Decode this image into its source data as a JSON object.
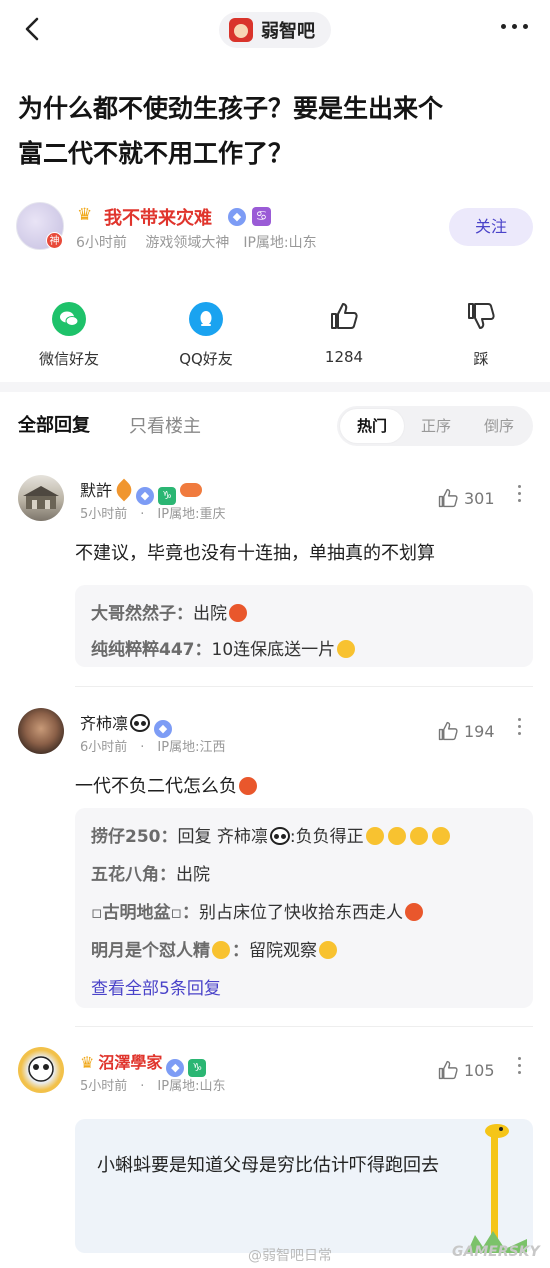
{
  "header": {
    "forum_name": "弱智吧"
  },
  "post": {
    "title_line1": "为什么都不使劲生孩子？要是生出来个",
    "title_line2": "富二代不就不用工作了？"
  },
  "author": {
    "name": "我不带来灾难",
    "badge": "神",
    "meta": "6小时前　 游戏领域大神　IP属地:山东",
    "follow_label": "关注"
  },
  "share": {
    "wechat": "微信好友",
    "qq": "QQ好友",
    "likes": "1284",
    "dislike": "踩"
  },
  "tabs": {
    "all": "全部回复",
    "op_only": "只看楼主",
    "sort": [
      "热门",
      "正序",
      "倒序"
    ]
  },
  "comments": [
    {
      "name": "默許",
      "meta": "5小时前　·　IP属地:重庆",
      "likes": "301",
      "text": "不建议，毕竟也没有十连抽，单抽真的不划算",
      "replies": [
        {
          "user": "大哥然然子：",
          "text": "出院"
        },
        {
          "user": "纯纯粹粹447：",
          "text": "10连保底送一片"
        }
      ]
    },
    {
      "name": "齐柿凛",
      "meta": "6小时前　·　IP属地:江西",
      "likes": "194",
      "text": "一代不负二代怎么负",
      "replies": [
        {
          "user": "捞仔250：",
          "text": "回复 齐柿凛",
          "text2": ":负负得正"
        },
        {
          "user": "五花八角：",
          "text": "出院"
        },
        {
          "user": "▫古明地盆▫：",
          "text": "别占床位了快收拾东西走人"
        },
        {
          "user": "明月是个怼人精",
          "text": "留院观察"
        }
      ],
      "view_all": "查看全部5条回复"
    },
    {
      "name": "沼澤學家",
      "meta": "5小时前　·　IP属地:山东",
      "likes": "105",
      "quote": "小蝌蚪要是知道父母是穷比估计吓得跑回去"
    }
  ],
  "watermark": "@弱智吧日常",
  "brand": "GAMERSKY",
  "colors": {
    "accent": "#4a43c9",
    "name_red": "#e0342c",
    "wechat": "#1ec26a",
    "qq": "#1aa3f0"
  }
}
